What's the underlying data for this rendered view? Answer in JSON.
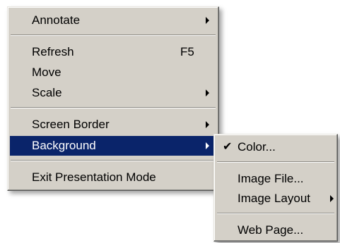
{
  "main_menu": {
    "items": [
      {
        "label": "Annotate",
        "has_submenu": true
      },
      {
        "label": "Refresh",
        "accelerator": "F5"
      },
      {
        "label": "Move"
      },
      {
        "label": "Scale",
        "has_submenu": true
      },
      {
        "label": "Screen Border",
        "has_submenu": true
      },
      {
        "label": "Background",
        "has_submenu": true,
        "highlighted": true
      },
      {
        "label": "Exit Presentation Mode"
      }
    ]
  },
  "background_submenu": {
    "items": [
      {
        "label": "Color...",
        "checked": true,
        "check_glyph": "✔"
      },
      {
        "label": "Image File..."
      },
      {
        "label": "Image Layout",
        "has_submenu": true
      },
      {
        "label": "Web Page..."
      }
    ]
  },
  "colors": {
    "menu_bg": "#d4d0c8",
    "highlight_bg": "#0a246a",
    "highlight_text": "#ffffff"
  },
  "icons": {
    "submenu_arrow": "triangle-right",
    "check": "checkmark"
  }
}
